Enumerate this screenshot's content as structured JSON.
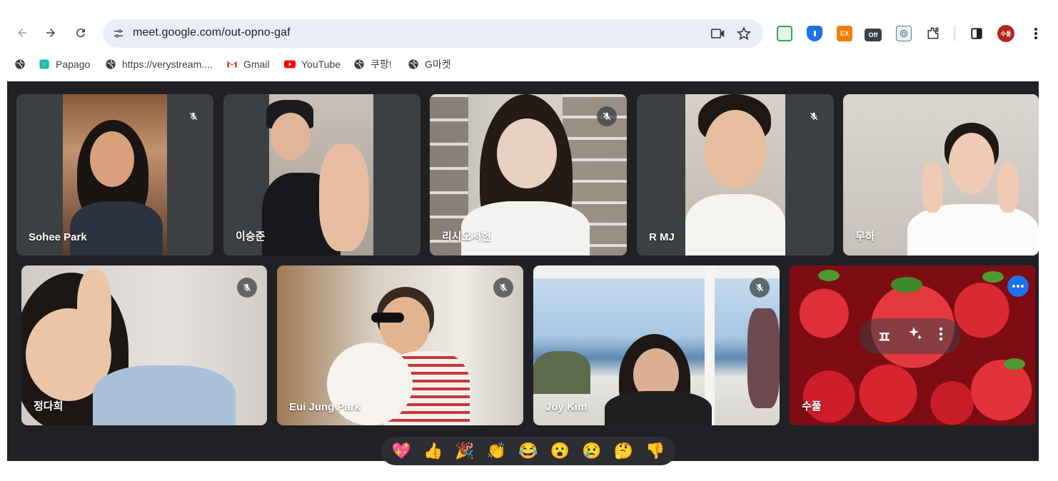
{
  "browser": {
    "url": "meet.google.com/out-opno-gaf",
    "profile_initials": "수풀",
    "extensions": [
      {
        "name": "green-extension-icon",
        "label": "",
        "color": "#34a853"
      },
      {
        "name": "shield-extension-icon",
        "label": "",
        "color": "#1a73e8"
      },
      {
        "name": "ex-extension-icon",
        "label": "EX",
        "color": "#f57c00"
      },
      {
        "name": "off-extension-icon",
        "label": "Off",
        "color": "#3c4043"
      },
      {
        "name": "fingerprint-extension-icon",
        "label": "",
        "color": "#607d8b"
      }
    ]
  },
  "bookmarks": [
    {
      "label": "",
      "icon": "globe-icon"
    },
    {
      "label": "Papago",
      "icon": "papago-icon"
    },
    {
      "label": "https://verystream....",
      "icon": "globe-icon"
    },
    {
      "label": "Gmail",
      "icon": "gmail-icon"
    },
    {
      "label": "YouTube",
      "icon": "youtube-icon"
    },
    {
      "label": "쿠팡!",
      "icon": "globe-icon"
    },
    {
      "label": "G마켓",
      "icon": "globe-icon"
    }
  ],
  "participants": [
    {
      "name": "Sohee Park",
      "muted": true
    },
    {
      "name": "이승준",
      "muted": false
    },
    {
      "name": "리시오서현",
      "muted": true
    },
    {
      "name": "R MJ",
      "muted": true
    },
    {
      "name": "무하",
      "muted": false
    },
    {
      "name": "정다희",
      "muted": true
    },
    {
      "name": "Eui Jung Park",
      "muted": true
    },
    {
      "name": "Joy Kim",
      "muted": true
    },
    {
      "name": "수풀",
      "muted": false,
      "self": true
    }
  ],
  "self_tile_overlay": {
    "left_glyph": "ㅍ",
    "effects_icon": "sparkle-icon",
    "menu_icon": "more-vert-icon"
  },
  "reactions": [
    "💖",
    "👍",
    "🎉",
    "👏",
    "😂",
    "😮",
    "😢",
    "🤔",
    "👎"
  ]
}
